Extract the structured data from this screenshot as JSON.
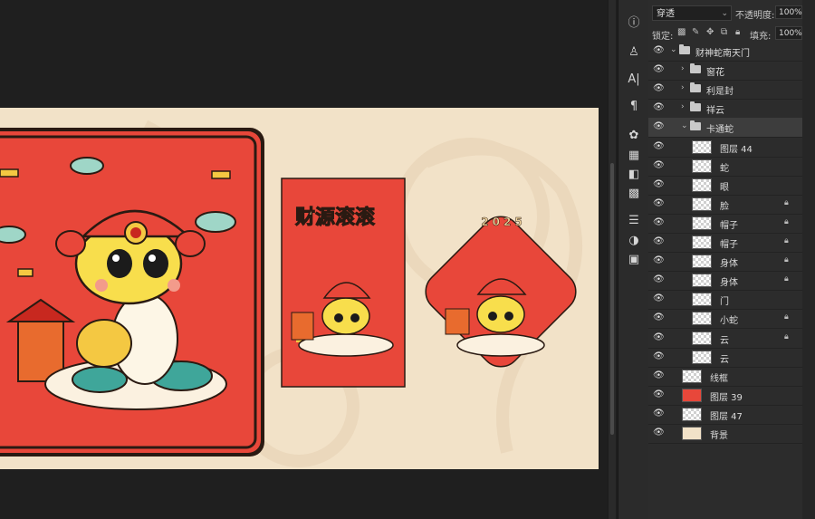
{
  "layers_panel": {
    "blend_mode": "穿透",
    "opacity_label": "不透明度:",
    "opacity_value": "100%",
    "lock_label": "锁定:",
    "fill_label": "填充:",
    "fill_value": "100%",
    "layers": [
      {
        "name": "财神蛇南天门",
        "type": "group",
        "expanded": true,
        "indent": 0
      },
      {
        "name": "窗花",
        "type": "group",
        "expanded": false,
        "indent": 1
      },
      {
        "name": "利是封",
        "type": "group",
        "expanded": false,
        "indent": 1
      },
      {
        "name": "祥云",
        "type": "group",
        "expanded": false,
        "indent": 1
      },
      {
        "name": "卡通蛇",
        "type": "group",
        "expanded": true,
        "indent": 1,
        "selected": true
      },
      {
        "name": "图层 44",
        "type": "layer",
        "indent": 2
      },
      {
        "name": "蛇",
        "type": "layer",
        "indent": 2
      },
      {
        "name": "眼",
        "type": "layer",
        "indent": 2
      },
      {
        "name": "脸",
        "type": "layer",
        "indent": 2,
        "locked": true
      },
      {
        "name": "帽子",
        "type": "layer",
        "indent": 2,
        "locked": true
      },
      {
        "name": "帽子",
        "type": "layer",
        "indent": 2,
        "locked": true
      },
      {
        "name": "身体",
        "type": "layer",
        "indent": 2,
        "locked": true
      },
      {
        "name": "身体",
        "type": "layer",
        "indent": 2,
        "locked": true
      },
      {
        "name": "门",
        "type": "layer",
        "indent": 2
      },
      {
        "name": "小蛇",
        "type": "layer",
        "indent": 2,
        "locked": true
      },
      {
        "name": "云",
        "type": "layer",
        "indent": 2,
        "locked": true
      },
      {
        "name": "云",
        "type": "layer",
        "indent": 2
      },
      {
        "name": "线框",
        "type": "layer",
        "indent": 1
      },
      {
        "name": "图层 39",
        "type": "layer",
        "indent": 1,
        "thumb_color": "#e8473a"
      },
      {
        "name": "图层 47",
        "type": "layer",
        "indent": 1
      },
      {
        "name": "背景",
        "type": "layer",
        "indent": 1,
        "thumb_color": "#f2e2c8"
      }
    ]
  },
  "artwork": {
    "poster_title": "财源滚滚",
    "badge_year": "2025"
  },
  "colors": {
    "canvas_bg": "#f2e2c8",
    "red": "#e8473a",
    "dark_red": "#c8281f",
    "gold": "#f4c842",
    "teal": "#3fa69a"
  },
  "tools": [
    "info-icon",
    "3d-icon",
    "character-icon",
    "paragraph-icon",
    "swatches-icon",
    "table-icon",
    "gradient-icon",
    "pattern-icon",
    "adjustments-icon",
    "layer-comp-icon",
    "clone-source-icon"
  ]
}
